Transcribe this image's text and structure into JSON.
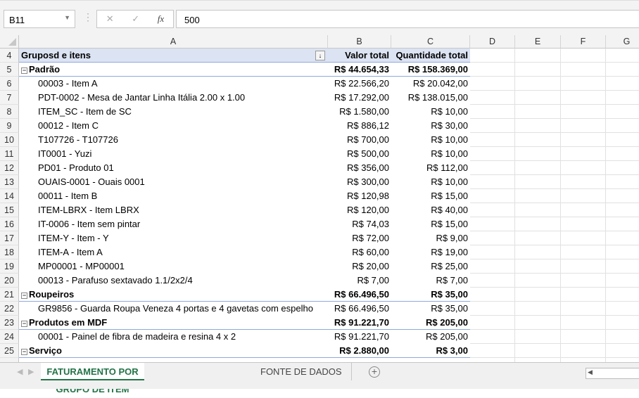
{
  "formula_bar": {
    "name_box": "B11",
    "formula": "500",
    "cancel_icon": "✕",
    "enter_icon": "✓",
    "fx_label": "fx"
  },
  "columns": [
    "A",
    "B",
    "C",
    "D",
    "E",
    "F",
    "G"
  ],
  "pivot": {
    "header": {
      "row": "4",
      "col_a": "Gruposd e itens",
      "col_b": "Valor total",
      "col_c": "Quantidade total"
    },
    "rows": [
      {
        "row": "5",
        "type": "group",
        "label": "Padrão",
        "valor": "R$ 44.654,33",
        "qtd": "R$ 158.369,00"
      },
      {
        "row": "6",
        "type": "item",
        "label": "00003 - Item A",
        "valor": "R$ 22.566,20",
        "qtd": "R$ 20.042,00"
      },
      {
        "row": "7",
        "type": "item",
        "label": "PDT-0002 - Mesa de Jantar Linha Itália 2.00 x 1.00",
        "valor": "R$ 17.292,00",
        "qtd": "R$ 138.015,00"
      },
      {
        "row": "8",
        "type": "item",
        "label": "ITEM_SC - Item de SC",
        "valor": "R$ 1.580,00",
        "qtd": "R$ 10,00"
      },
      {
        "row": "9",
        "type": "item",
        "label": "00012 - Item C",
        "valor": "R$ 886,12",
        "qtd": "R$ 30,00"
      },
      {
        "row": "10",
        "type": "item",
        "label": "T107726 - T107726",
        "valor": "R$ 700,00",
        "qtd": "R$ 10,00"
      },
      {
        "row": "11",
        "type": "item",
        "label": "IT0001 - Yuzi",
        "valor": "R$ 500,00",
        "qtd": "R$ 10,00"
      },
      {
        "row": "12",
        "type": "item",
        "label": "PD01 - Produto 01",
        "valor": "R$ 356,00",
        "qtd": "R$ 112,00"
      },
      {
        "row": "13",
        "type": "item",
        "label": "OUAIS-0001 - Ouais 0001",
        "valor": "R$ 300,00",
        "qtd": "R$ 10,00"
      },
      {
        "row": "14",
        "type": "item",
        "label": "00011 - Item B",
        "valor": "R$ 120,98",
        "qtd": "R$ 15,00"
      },
      {
        "row": "15",
        "type": "item",
        "label": "ITEM-LBRX - Item LBRX",
        "valor": "R$ 120,00",
        "qtd": "R$ 40,00"
      },
      {
        "row": "16",
        "type": "item",
        "label": "IT-0006 - Item sem pintar",
        "valor": "R$ 74,03",
        "qtd": "R$ 15,00"
      },
      {
        "row": "17",
        "type": "item",
        "label": "ITEM-Y - Item - Y",
        "valor": "R$ 72,00",
        "qtd": "R$ 9,00"
      },
      {
        "row": "18",
        "type": "item",
        "label": "ITEM-A - Item A",
        "valor": "R$ 60,00",
        "qtd": "R$ 19,00"
      },
      {
        "row": "19",
        "type": "item",
        "label": "MP00001 - MP00001",
        "valor": "R$ 20,00",
        "qtd": "R$ 25,00"
      },
      {
        "row": "20",
        "type": "item",
        "label": "00013 - Parafuso sextavado 1.1/2x2/4",
        "valor": "R$ 7,00",
        "qtd": "R$ 7,00"
      },
      {
        "row": "21",
        "type": "group",
        "label": "Roupeiros",
        "valor": "R$ 66.496,50",
        "qtd": "R$ 35,00"
      },
      {
        "row": "22",
        "type": "item",
        "label": "GR9856 - Guarda Roupa Veneza 4 portas e 4 gavetas com espelho",
        "valor": "R$ 66.496,50",
        "qtd": "R$ 35,00"
      },
      {
        "row": "23",
        "type": "group",
        "label": "Produtos em MDF",
        "valor": "R$ 91.221,70",
        "qtd": "R$ 205,00"
      },
      {
        "row": "24",
        "type": "item",
        "label": "00001 - Painel de fibra de madeira e resina 4 x 2",
        "valor": "R$ 91.221,70",
        "qtd": "R$ 205,00"
      },
      {
        "row": "25",
        "type": "group",
        "label": "Serviço",
        "valor": "R$ 2.880,00",
        "qtd": "R$ 3,00"
      }
    ]
  },
  "sheet_tabs": [
    {
      "label": "FATURAMENTO POR GRUPO DE ITEM",
      "active": true
    },
    {
      "label": "FONTE DE DADOS",
      "active": false
    }
  ],
  "add_sheet_icon": "+"
}
